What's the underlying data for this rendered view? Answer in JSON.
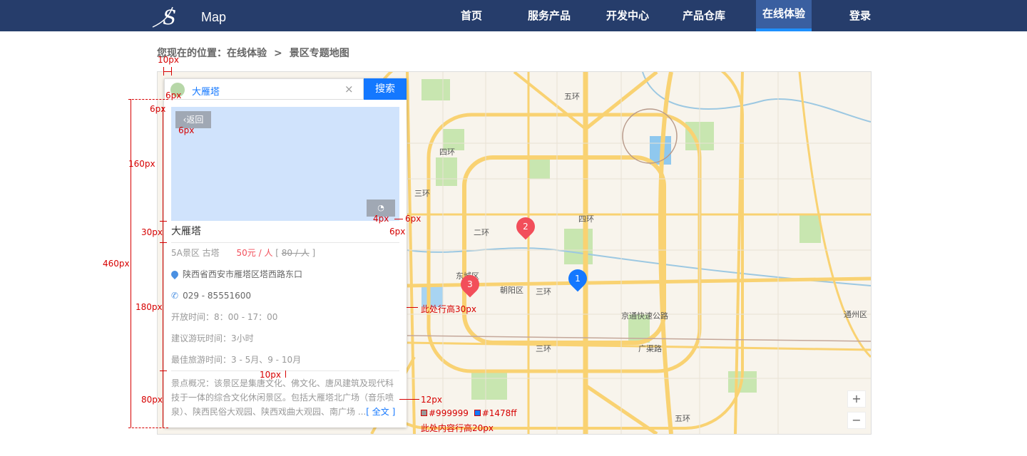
{
  "header": {
    "logo_text": "S",
    "logo_text2": "Map",
    "nav": [
      {
        "label": "首页"
      },
      {
        "label": "服务产品"
      },
      {
        "label": "开发中心"
      },
      {
        "label": "产品仓库"
      },
      {
        "label": "在线体验",
        "active": true
      },
      {
        "label": "登录"
      }
    ]
  },
  "breadcrumb": {
    "prefix": "您现在的位置：在线体验",
    "separator": ">",
    "current": "景区专题地图"
  },
  "panel": {
    "search_value": "大雁塔",
    "search_button": "搜索",
    "back_label": "返回",
    "poi_title": "大雁塔",
    "tags": "5A景区  古塔",
    "price": "50元 / 人",
    "price_original": "80 / 人",
    "address": "陕西省西安市雁塔区塔西路东口",
    "phone": "029 - 85551600",
    "open_time": "开放时间：8：00 - 17：00",
    "suggest_time": "建议游玩时间：3小时",
    "best_time": "最佳旅游时间：3 - 5月、9 - 10月",
    "overview": "景点概况：该景区是集唐文化、佛文化、唐风建筑及现代科技于一体的综合文化休闲景区。包括大雁塔北广场（音乐喷泉）、陕西民俗大观园、陕西戏曲大观园、南广场 ...",
    "more_label": "[ 全文 ]"
  },
  "map": {
    "markers": [
      {
        "label": "2",
        "color": "#f24e5a"
      },
      {
        "label": "1",
        "color": "#1478ff"
      },
      {
        "label": "3",
        "color": "#f24e5a"
      }
    ],
    "labels": [
      "四环",
      "三环",
      "二环",
      "五环",
      "四环",
      "东城区",
      "朝阳区",
      "三环",
      "京通快速公路",
      "广渠路",
      "通州区",
      "三环",
      "五环"
    ],
    "zoom_in": "+",
    "zoom_out": "−"
  },
  "annotations": {
    "a10": "10px",
    "a6a": "6px",
    "a6b": "6px",
    "a6c": "6px",
    "a160": "160px",
    "a460": "460px",
    "a4": "4px",
    "a6d": "6px",
    "a6e": "6px",
    "a30": "30px",
    "a180": "180px",
    "a80": "80px",
    "line_height": "此处行高30px",
    "a10b": "10px",
    "a12": "12px",
    "color1": "#999999",
    "color2": "#1478ff",
    "content_height": "此处内容行高20px"
  },
  "colors": {
    "header": "#263d6b",
    "accent": "#1478ff",
    "price": "#f24e5a",
    "annotation": "#d60000"
  }
}
